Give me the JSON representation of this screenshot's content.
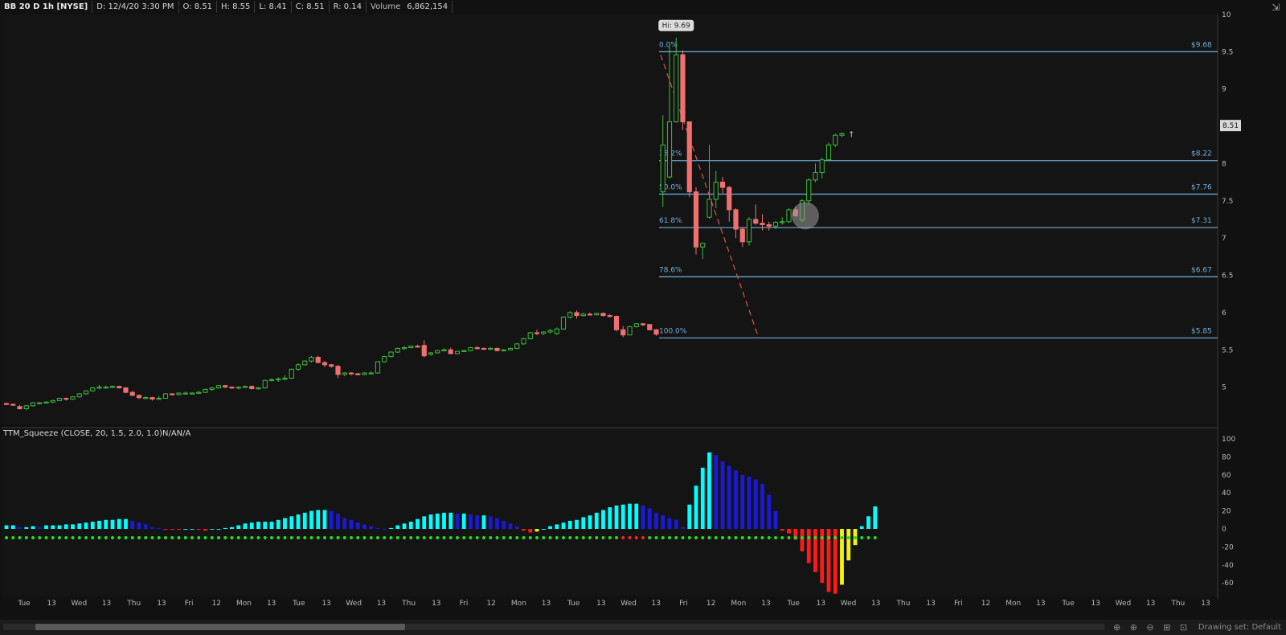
{
  "header": {
    "symbol": "BB 20 D 1h [NYSE]",
    "date": "D: 12/4/20 3:30 PM",
    "open": "O: 8.51",
    "high": "H: 8.55",
    "low": "L: 8.41",
    "close": "C: 8.51",
    "range": "R: 0.14",
    "volume_label": "Volume",
    "volume": "6,862,154"
  },
  "lower_study_label": "TTM_Squeeze (CLOSE, 20, 1.5, 2.0, 1.0)N/AN/A",
  "footer": {
    "drawing_set": "Drawing set: Default",
    "tool_icons": "⊕ ⊕ ⊖ ⊞ ⊡"
  },
  "colors": {
    "background": "#141414",
    "grid": "#262626",
    "up": "#3dbb3d",
    "down": "#f07070",
    "fib": "#6fb0de",
    "trend": "#e0524c",
    "hist_cyan": "#00ffff",
    "hist_blue": "#1a1ad6",
    "hist_red": "#ff1a1a",
    "hist_yellow": "#f2f20d",
    "dot_green": "#20e020",
    "dot_red": "#ff2020"
  },
  "chart_data": [
    {
      "type": "candlestick",
      "title": "BB 20 D 1h [NYSE]",
      "ylim": [
        4.5,
        10
      ],
      "yticks": [
        5,
        5.5,
        6,
        6.5,
        7,
        7.5,
        8,
        8.5,
        9,
        9.5,
        10
      ],
      "last_price_label": "8.51",
      "hi_label": "Hi: 9.69",
      "x_labels": [
        "Tue",
        "13",
        "Wed",
        "13",
        "Thu",
        "13",
        "Fri",
        "12",
        "Mon",
        "13",
        "Tue",
        "13",
        "Wed",
        "13",
        "Thu",
        "13",
        "Fri",
        "12",
        "Mon",
        "13",
        "Tue",
        "13",
        "Wed",
        "13",
        "Fri",
        "12",
        "Mon",
        "13",
        "Tue",
        "13",
        "Wed",
        "13",
        "Thu",
        "13",
        "Fri",
        "12",
        "Mon",
        "13",
        "Tue",
        "13",
        "Wed",
        "13",
        "Thu",
        "13"
      ],
      "fib_levels": [
        {
          "pct": "0.0%",
          "price": "$9.68",
          "value": 9.5
        },
        {
          "pct": "38.2%",
          "price": "$8.22",
          "value": 8.04
        },
        {
          "pct": "50.0%",
          "price": "$7.76",
          "value": 7.59
        },
        {
          "pct": "61.8%",
          "price": "$7.31",
          "value": 7.14
        },
        {
          "pct": "78.6%",
          "price": "$6.67",
          "value": 6.48
        },
        {
          "pct": "100.0%",
          "price": "$5.85",
          "value": 5.66
        }
      ],
      "candles": [
        [
          4.78,
          4.79,
          4.76,
          4.77
        ],
        [
          4.77,
          4.78,
          4.75,
          4.76
        ],
        [
          4.74,
          4.76,
          4.7,
          4.71
        ],
        [
          4.71,
          4.76,
          4.69,
          4.75
        ],
        [
          4.75,
          4.8,
          4.74,
          4.79
        ],
        [
          4.79,
          4.8,
          4.77,
          4.79
        ],
        [
          4.79,
          4.81,
          4.78,
          4.8
        ],
        [
          4.8,
          4.83,
          4.79,
          4.82
        ],
        [
          4.82,
          4.86,
          4.81,
          4.85
        ],
        [
          4.85,
          4.86,
          4.82,
          4.84
        ],
        [
          4.84,
          4.88,
          4.83,
          4.87
        ],
        [
          4.87,
          4.92,
          4.86,
          4.91
        ],
        [
          4.91,
          4.96,
          4.9,
          4.95
        ],
        [
          4.95,
          5.0,
          4.94,
          4.99
        ],
        [
          4.99,
          5.03,
          4.97,
          5.0
        ],
        [
          5.0,
          5.02,
          4.98,
          5.0
        ],
        [
          5.0,
          5.02,
          4.99,
          5.01
        ],
        [
          5.01,
          5.02,
          4.98,
          4.99
        ],
        [
          4.99,
          5.0,
          4.92,
          4.93
        ],
        [
          4.93,
          4.95,
          4.88,
          4.89
        ],
        [
          4.89,
          4.9,
          4.84,
          4.86
        ],
        [
          4.86,
          4.88,
          4.84,
          4.86
        ],
        [
          4.86,
          4.87,
          4.82,
          4.84
        ],
        [
          4.84,
          4.88,
          4.83,
          4.85
        ],
        [
          4.85,
          4.92,
          4.85,
          4.91
        ],
        [
          4.91,
          4.92,
          4.89,
          4.9
        ],
        [
          4.9,
          4.93,
          4.89,
          4.92
        ],
        [
          4.92,
          4.94,
          4.9,
          4.92
        ],
        [
          4.92,
          4.93,
          4.91,
          4.92
        ],
        [
          4.92,
          4.95,
          4.91,
          4.93
        ],
        [
          4.93,
          4.98,
          4.92,
          4.97
        ],
        [
          4.97,
          5.0,
          4.95,
          4.99
        ],
        [
          4.99,
          5.03,
          4.98,
          5.02
        ],
        [
          5.02,
          5.03,
          4.99,
          5.0
        ],
        [
          5.0,
          5.01,
          4.98,
          4.99
        ],
        [
          4.99,
          5.01,
          4.97,
          5.0
        ],
        [
          5.0,
          5.02,
          4.99,
          5.01
        ],
        [
          5.01,
          5.02,
          4.97,
          4.98
        ],
        [
          4.98,
          5.0,
          4.97,
          4.99
        ],
        [
          4.99,
          5.1,
          4.98,
          5.09
        ],
        [
          5.09,
          5.12,
          5.08,
          5.1
        ],
        [
          5.1,
          5.13,
          5.07,
          5.11
        ],
        [
          5.11,
          5.16,
          5.09,
          5.12
        ],
        [
          5.12,
          5.25,
          5.11,
          5.24
        ],
        [
          5.24,
          5.32,
          5.22,
          5.3
        ],
        [
          5.3,
          5.36,
          5.29,
          5.35
        ],
        [
          5.35,
          5.42,
          5.33,
          5.4
        ],
        [
          5.4,
          5.42,
          5.32,
          5.33
        ],
        [
          5.33,
          5.35,
          5.27,
          5.3
        ],
        [
          5.3,
          5.31,
          5.26,
          5.28
        ],
        [
          5.28,
          5.3,
          5.12,
          5.17
        ],
        [
          5.17,
          5.2,
          5.15,
          5.19
        ],
        [
          5.19,
          5.2,
          5.16,
          5.18
        ],
        [
          5.18,
          5.19,
          5.16,
          5.17
        ],
        [
          5.17,
          5.2,
          5.16,
          5.19
        ],
        [
          5.19,
          5.21,
          5.17,
          5.19
        ],
        [
          5.19,
          5.35,
          5.18,
          5.34
        ],
        [
          5.34,
          5.42,
          5.33,
          5.41
        ],
        [
          5.41,
          5.48,
          5.4,
          5.47
        ],
        [
          5.47,
          5.53,
          5.46,
          5.52
        ],
        [
          5.52,
          5.55,
          5.5,
          5.53
        ],
        [
          5.53,
          5.56,
          5.52,
          5.55
        ],
        [
          5.55,
          5.57,
          5.53,
          5.54
        ],
        [
          5.56,
          5.63,
          5.4,
          5.42
        ],
        [
          5.44,
          5.47,
          5.42,
          5.46
        ],
        [
          5.46,
          5.5,
          5.45,
          5.49
        ],
        [
          5.49,
          5.52,
          5.48,
          5.5
        ],
        [
          5.5,
          5.53,
          5.44,
          5.45
        ],
        [
          5.45,
          5.49,
          5.44,
          5.48
        ],
        [
          5.48,
          5.5,
          5.47,
          5.49
        ],
        [
          5.49,
          5.54,
          5.48,
          5.53
        ],
        [
          5.53,
          5.55,
          5.5,
          5.52
        ],
        [
          5.52,
          5.53,
          5.5,
          5.51
        ],
        [
          5.51,
          5.54,
          5.5,
          5.52
        ],
        [
          5.52,
          5.53,
          5.48,
          5.49
        ],
        [
          5.49,
          5.51,
          5.48,
          5.5
        ],
        [
          5.5,
          5.53,
          5.49,
          5.52
        ],
        [
          5.52,
          5.59,
          5.51,
          5.58
        ],
        [
          5.58,
          5.66,
          5.57,
          5.65
        ],
        [
          5.65,
          5.74,
          5.64,
          5.73
        ],
        [
          5.73,
          5.77,
          5.7,
          5.72
        ],
        [
          5.72,
          5.75,
          5.7,
          5.74
        ],
        [
          5.74,
          5.78,
          5.72,
          5.76
        ],
        [
          5.72,
          5.8,
          5.7,
          5.78
        ],
        [
          5.78,
          5.95,
          5.77,
          5.94
        ],
        [
          5.94,
          6.02,
          5.92,
          6.0
        ],
        [
          6.0,
          6.03,
          5.92,
          5.96
        ],
        [
          5.96,
          6.0,
          5.95,
          5.98
        ],
        [
          5.98,
          6.0,
          5.96,
          5.97
        ],
        [
          5.97,
          6.0,
          5.96,
          5.99
        ],
        [
          5.99,
          6.0,
          5.95,
          5.96
        ],
        [
          5.96,
          5.98,
          5.94,
          5.95
        ],
        [
          5.95,
          5.96,
          5.75,
          5.77
        ],
        [
          5.77,
          5.82,
          5.67,
          5.7
        ],
        [
          5.7,
          5.82,
          5.7,
          5.81
        ],
        [
          5.81,
          5.86,
          5.8,
          5.85
        ],
        [
          5.85,
          5.86,
          5.82,
          5.84
        ],
        [
          5.84,
          5.85,
          5.76,
          5.77
        ],
        [
          5.77,
          5.78,
          5.69,
          5.71
        ],
        [
          7.62,
          8.65,
          7.42,
          8.25
        ],
        [
          7.82,
          9.6,
          7.8,
          8.56
        ],
        [
          8.56,
          9.69,
          8.55,
          9.46
        ],
        [
          9.46,
          9.52,
          8.45,
          8.56
        ],
        [
          8.56,
          8.56,
          7.55,
          7.62
        ],
        [
          7.62,
          7.68,
          6.78,
          6.88
        ],
        [
          6.88,
          6.92,
          6.72,
          6.93
        ],
        [
          7.28,
          8.25,
          7.26,
          7.52
        ],
        [
          7.52,
          7.9,
          7.4,
          7.75
        ],
        [
          7.75,
          7.82,
          7.6,
          7.68
        ],
        [
          7.68,
          7.7,
          7.22,
          7.38
        ],
        [
          7.38,
          7.4,
          7.0,
          7.12
        ],
        [
          7.12,
          7.15,
          6.88,
          6.95
        ],
        [
          6.95,
          7.28,
          6.9,
          7.25
        ],
        [
          7.25,
          7.45,
          7.18,
          7.2
        ],
        [
          7.2,
          7.32,
          7.1,
          7.18
        ],
        [
          7.18,
          7.22,
          7.1,
          7.16
        ],
        [
          7.16,
          7.23,
          7.12,
          7.21
        ],
        [
          7.21,
          7.28,
          7.18,
          7.22
        ],
        [
          7.22,
          7.4,
          7.2,
          7.38
        ],
        [
          7.38,
          7.42,
          7.28,
          7.3
        ],
        [
          7.24,
          7.52,
          7.22,
          7.5
        ],
        [
          7.5,
          7.8,
          7.45,
          7.78
        ],
        [
          7.78,
          8.0,
          7.75,
          7.88
        ],
        [
          7.88,
          8.08,
          7.8,
          8.05
        ],
        [
          8.05,
          8.28,
          8.03,
          8.25
        ],
        [
          8.25,
          8.4,
          8.22,
          8.38
        ],
        [
          8.38,
          8.42,
          8.35,
          8.4
        ]
      ]
    },
    {
      "type": "bar",
      "title": "TTM_Squeeze (CLOSE, 20, 1.5, 2.0, 1.0)N/AN/A",
      "ylim": [
        -75,
        100
      ],
      "yticks": [
        -60,
        -40,
        -20,
        0,
        20,
        40,
        60,
        80,
        100
      ],
      "values": [
        4,
        4,
        2,
        2,
        3,
        2,
        4,
        4,
        4,
        5,
        5,
        6,
        7,
        8,
        9,
        10,
        10,
        11,
        11,
        9,
        7,
        5,
        2,
        1,
        -1,
        -1,
        -1,
        0,
        0,
        -1,
        -2,
        0,
        0,
        1,
        2,
        4,
        6,
        7,
        8,
        8,
        8,
        10,
        12,
        14,
        16,
        18,
        20,
        21,
        21,
        20,
        17,
        12,
        10,
        7,
        5,
        3,
        1,
        0,
        1,
        4,
        6,
        8,
        11,
        14,
        16,
        17,
        18,
        18,
        17,
        17,
        16,
        15,
        15,
        14,
        12,
        9,
        6,
        3,
        -2,
        -4,
        -3,
        0,
        3,
        5,
        7,
        9,
        10,
        13,
        15,
        18,
        21,
        24,
        26,
        27,
        28,
        28,
        26,
        23,
        18,
        15,
        12,
        10,
        2,
        27,
        48,
        68,
        85,
        82,
        75,
        70,
        65,
        60,
        58,
        55,
        50,
        38,
        20,
        -2,
        -5,
        -12,
        -25,
        -38,
        -48,
        -60,
        -70,
        -72,
        -62,
        -35,
        -18,
        3,
        14,
        25
      ]
    }
  ]
}
